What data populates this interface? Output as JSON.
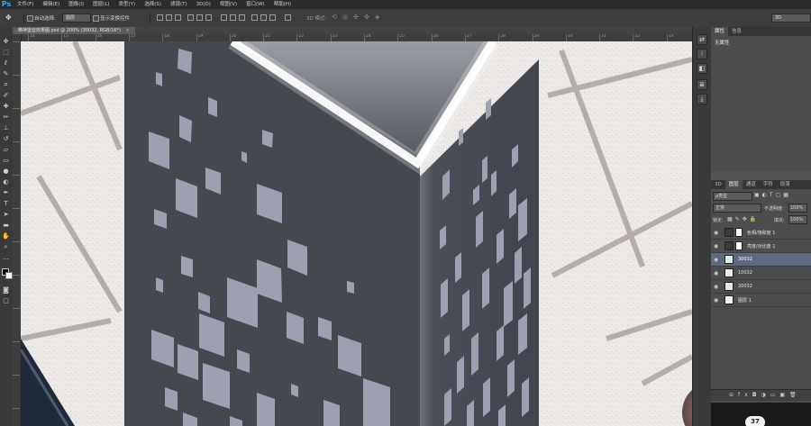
{
  "app": {
    "logo": "Ps",
    "menu": [
      "文件(F)",
      "编辑(E)",
      "图像(I)",
      "图层(L)",
      "类型(Y)",
      "选择(S)",
      "滤镜(T)",
      "3D(D)",
      "视图(V)",
      "窗口(W)",
      "帮助(H)"
    ]
  },
  "options_bar": {
    "auto_select_label": "自动选择:",
    "auto_select_value": "图层",
    "show_transform_label": "显示变换控件",
    "mode_3d_label": "3D 模式:",
    "workspace_value": "3D"
  },
  "document": {
    "tab_title": "精神堡垒效果图.psd @ 200% (30032, RGB/16*)"
  },
  "ruler": {
    "top_labels": [
      "14",
      "15",
      "16",
      "17",
      "18",
      "19",
      "20",
      "21",
      "22",
      "23",
      "24",
      "25",
      "26",
      "27",
      "28",
      "29",
      "30",
      "31",
      "32",
      "33"
    ]
  },
  "properties_panel": {
    "tabs": [
      "属性",
      "信息"
    ],
    "content": "无属性"
  },
  "layers_panel": {
    "tabs": [
      "3D",
      "图层",
      "通道",
      "字符",
      "段落"
    ],
    "filter_label": "ρ类型",
    "blend_mode": "正常",
    "opacity_label": "不透明度:",
    "opacity_value": "100%",
    "lock_label": "锁定:",
    "fill_label": "填充:",
    "fill_value": "100%",
    "layers": [
      {
        "name": "色相/饱和度 1",
        "type": "adjustment",
        "selected": false
      },
      {
        "name": "亮度/对比度 1",
        "type": "adjustment",
        "selected": false
      },
      {
        "name": "30032",
        "type": "smart",
        "selected": true
      },
      {
        "name": "10032",
        "type": "smart",
        "selected": false
      },
      {
        "name": "20032",
        "type": "smart",
        "selected": false
      },
      {
        "name": "图层 1",
        "type": "pixel",
        "selected": false
      }
    ],
    "bottom_badge": "37"
  },
  "colors": {
    "accent": "#31a8ff",
    "panel_bg": "#4d4d4d",
    "selected_row": "#5e6a80",
    "tower": "#454952",
    "tiles": "#9da0b0"
  }
}
